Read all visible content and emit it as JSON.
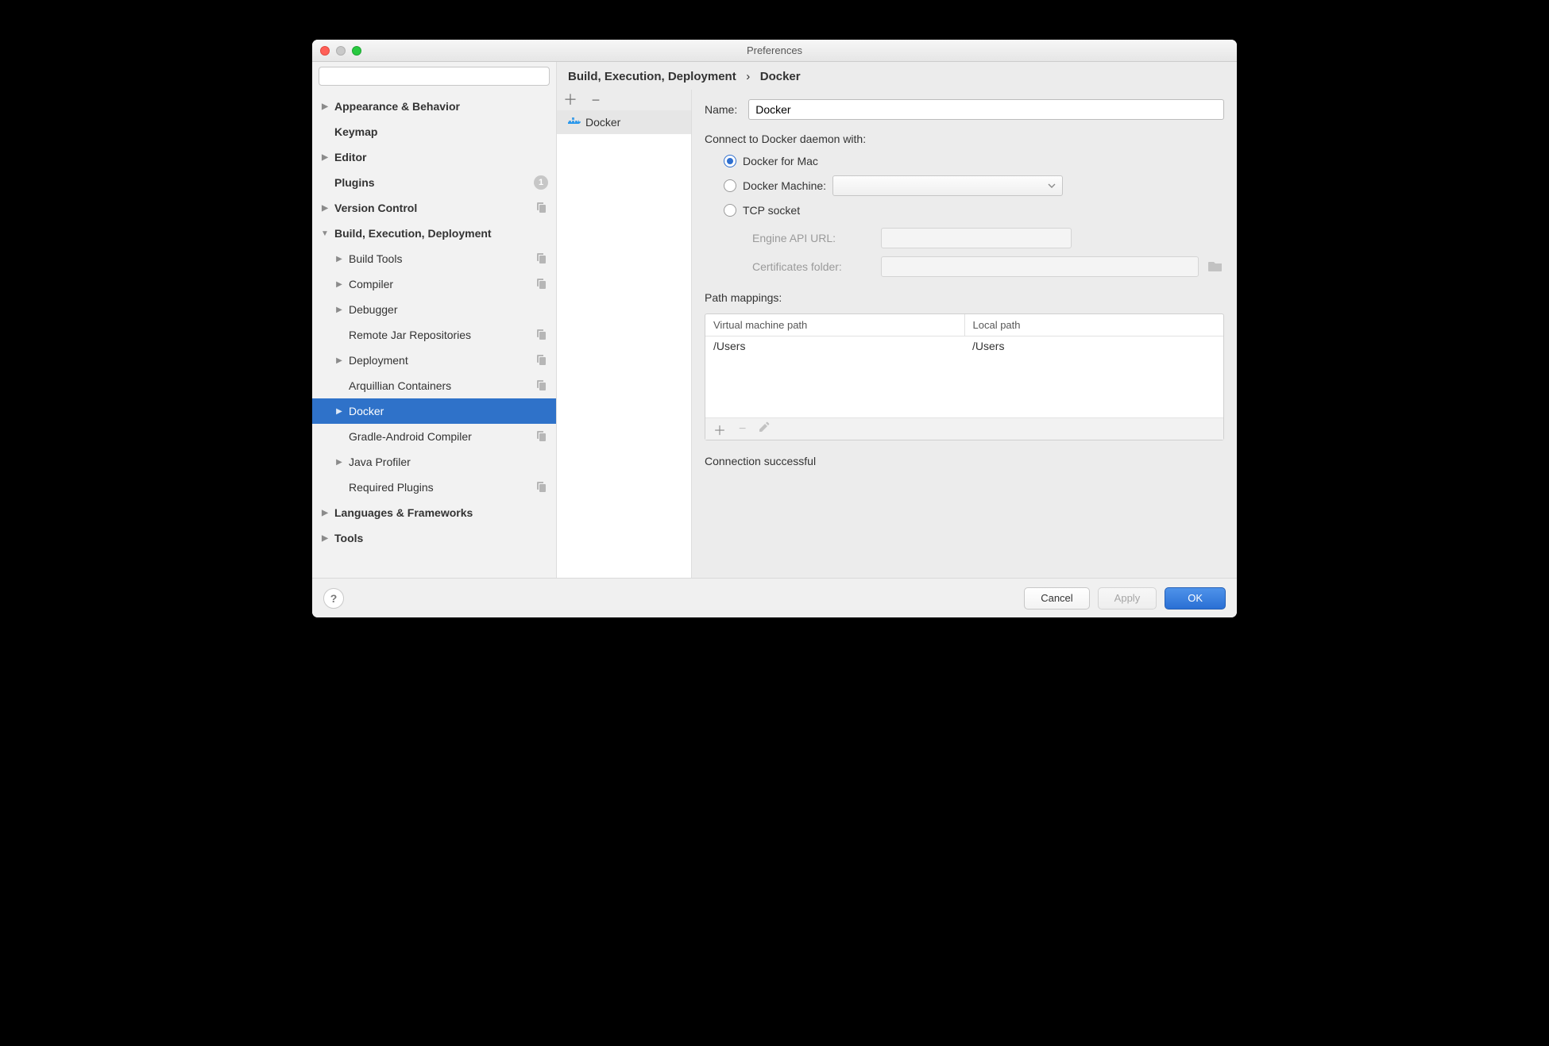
{
  "window": {
    "title": "Preferences"
  },
  "search": {
    "placeholder": ""
  },
  "sidebar": {
    "items": [
      {
        "label": "Appearance & Behavior",
        "bold": true,
        "arrow": "right",
        "indent": 0
      },
      {
        "label": "Keymap",
        "bold": true,
        "arrow": "",
        "indent": 0
      },
      {
        "label": "Editor",
        "bold": true,
        "arrow": "right",
        "indent": 0
      },
      {
        "label": "Plugins",
        "bold": true,
        "arrow": "",
        "indent": 0,
        "badge": "1"
      },
      {
        "label": "Version Control",
        "bold": true,
        "arrow": "right",
        "indent": 0,
        "copy": true
      },
      {
        "label": "Build, Execution, Deployment",
        "bold": true,
        "arrow": "down",
        "indent": 0
      },
      {
        "label": "Build Tools",
        "bold": false,
        "arrow": "right",
        "indent": 1,
        "copy": true
      },
      {
        "label": "Compiler",
        "bold": false,
        "arrow": "right",
        "indent": 1,
        "copy": true
      },
      {
        "label": "Debugger",
        "bold": false,
        "arrow": "right",
        "indent": 1
      },
      {
        "label": "Remote Jar Repositories",
        "bold": false,
        "arrow": "",
        "indent": 1,
        "copy": true
      },
      {
        "label": "Deployment",
        "bold": false,
        "arrow": "right",
        "indent": 1,
        "copy": true
      },
      {
        "label": "Arquillian Containers",
        "bold": false,
        "arrow": "",
        "indent": 1,
        "copy": true
      },
      {
        "label": "Docker",
        "bold": false,
        "arrow": "right",
        "indent": 1,
        "selected": true
      },
      {
        "label": "Gradle-Android Compiler",
        "bold": false,
        "arrow": "",
        "indent": 1,
        "copy": true
      },
      {
        "label": "Java Profiler",
        "bold": false,
        "arrow": "right",
        "indent": 1
      },
      {
        "label": "Required Plugins",
        "bold": false,
        "arrow": "",
        "indent": 1,
        "copy": true
      },
      {
        "label": "Languages & Frameworks",
        "bold": true,
        "arrow": "right",
        "indent": 0
      },
      {
        "label": "Tools",
        "bold": true,
        "arrow": "right",
        "indent": 0
      }
    ]
  },
  "breadcrumb": {
    "root": "Build, Execution, Deployment",
    "sep": "›",
    "leaf": "Docker"
  },
  "list": {
    "items": [
      {
        "label": "Docker"
      }
    ]
  },
  "form": {
    "name_label": "Name:",
    "name_value": "Docker",
    "connect_label": "Connect to Docker daemon with:",
    "radio_mac": "Docker for Mac",
    "radio_machine": "Docker Machine:",
    "radio_tcp": "TCP socket",
    "engine_api_label": "Engine API URL:",
    "engine_api_value": "",
    "cert_label": "Certificates folder:",
    "cert_value": "",
    "path_label": "Path mappings:",
    "table": {
      "col1": "Virtual machine path",
      "col2": "Local path",
      "rows": [
        {
          "vm": "/Users",
          "local": "/Users"
        }
      ]
    },
    "status": "Connection successful"
  },
  "footer": {
    "cancel": "Cancel",
    "apply": "Apply",
    "ok": "OK"
  }
}
